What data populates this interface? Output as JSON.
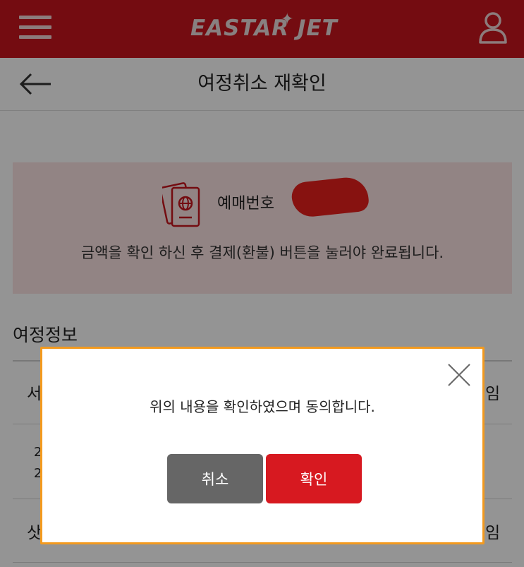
{
  "header": {
    "logo_text": "EASTAR JET"
  },
  "subheader": {
    "title": "여정취소 재확인"
  },
  "booking": {
    "label": "예매번호",
    "notice": "금액을 확인 하신 후 결제(환불) 버튼을 눌러야 완료됩니다."
  },
  "itinerary": {
    "title": "여정정보",
    "row1_left": "서",
    "row1_right": "임",
    "row2_left_a": "2",
    "row2_left_b": "2",
    "row3_left": "삿",
    "row3_right": "임"
  },
  "modal": {
    "message": "위의 내용을 확인하였으며 동의합니다.",
    "cancel_label": "취소",
    "confirm_label": "확인"
  },
  "colors": {
    "brand_red": "#c8161e",
    "confirm_red": "#d71920",
    "cancel_gray": "#666666",
    "modal_border": "#f39a1e"
  }
}
